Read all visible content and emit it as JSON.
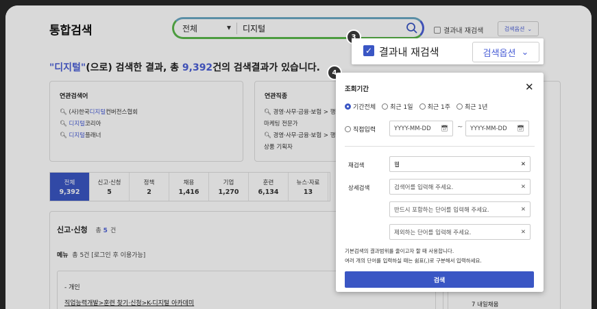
{
  "header": {
    "title": "통합검색",
    "search_category": "전체",
    "search_query": "디지털",
    "re_search_label": "결과내 재검색",
    "options_label": "검색옵션"
  },
  "result_summary": {
    "keyword": "\"디지털\"",
    "middle": "(으로) 검색한 결과, 총",
    "count": "9,392",
    "tail": "건의 검색결과가 있습니다."
  },
  "related_search": {
    "title": "연관검색어",
    "items": [
      {
        "pre": "(사)한국",
        "hl": "디지털",
        "post": "컨버전스협회"
      },
      {
        "pre": "",
        "hl": "디지털",
        "post": "코리아"
      },
      {
        "pre": "",
        "hl": "디지털",
        "post": "플래너"
      }
    ]
  },
  "related_jobs": {
    "title": "연관직종",
    "items": [
      "경영·사무·금융·보험 > 행",
      "마케팅 전문가",
      "경영·사무·금융·보험 > 행",
      "상품 기획자"
    ]
  },
  "tabs": [
    {
      "label": "전체",
      "count": "9,392"
    },
    {
      "label": "신고·신청",
      "count": "5"
    },
    {
      "label": "정책",
      "count": "2"
    },
    {
      "label": "채용",
      "count": "1,416"
    },
    {
      "label": "기업",
      "count": "1,270"
    },
    {
      "label": "훈련",
      "count": "6,134"
    },
    {
      "label": "뉴스·자료",
      "count": "13"
    }
  ],
  "section": {
    "title": "신고·신청",
    "total_pre": "총",
    "total_count": "5",
    "total_post": "건",
    "menu_label": "메뉴",
    "menu_total": "총 5건 [로그인 후 이용가능]",
    "item_category": "- 개인",
    "item_path": "직업능력개발>훈련 찾기·신청>K-디지털 아카데미"
  },
  "right_panel": {
    "item": "7 내일채움"
  },
  "callout3": {
    "badge": "3",
    "checkbox_label": "결과내 재검색",
    "options_button": "검색옵션"
  },
  "callout4": {
    "badge": "4",
    "title": "조회기간",
    "radios": [
      "기간전체",
      "최근 1일",
      "최근 1주",
      "최근 1년"
    ],
    "direct_input": "직접입력",
    "date_placeholder": "YYYY-MM-DD",
    "tilde": "~",
    "re_search_label": "재검색",
    "re_search_value": "웹",
    "detail_label": "상세검색",
    "ph_keyword": "검색어를 입력해 주세요.",
    "ph_include": "반드시 포함하는 단어를 입력해 주세요.",
    "ph_exclude": "제외하는 단어를 입력해 주세요.",
    "note1": "기본검색의 결과범위를 줄이고자 할 때 사용합니다.",
    "note2": "여러 개의 단어를 입력하실 때는 쉼표(,)로 구분해서 입력하세요.",
    "submit": "검색"
  },
  "colors": {
    "accent": "#3a56c4",
    "highlight": "#4a5fd6"
  }
}
